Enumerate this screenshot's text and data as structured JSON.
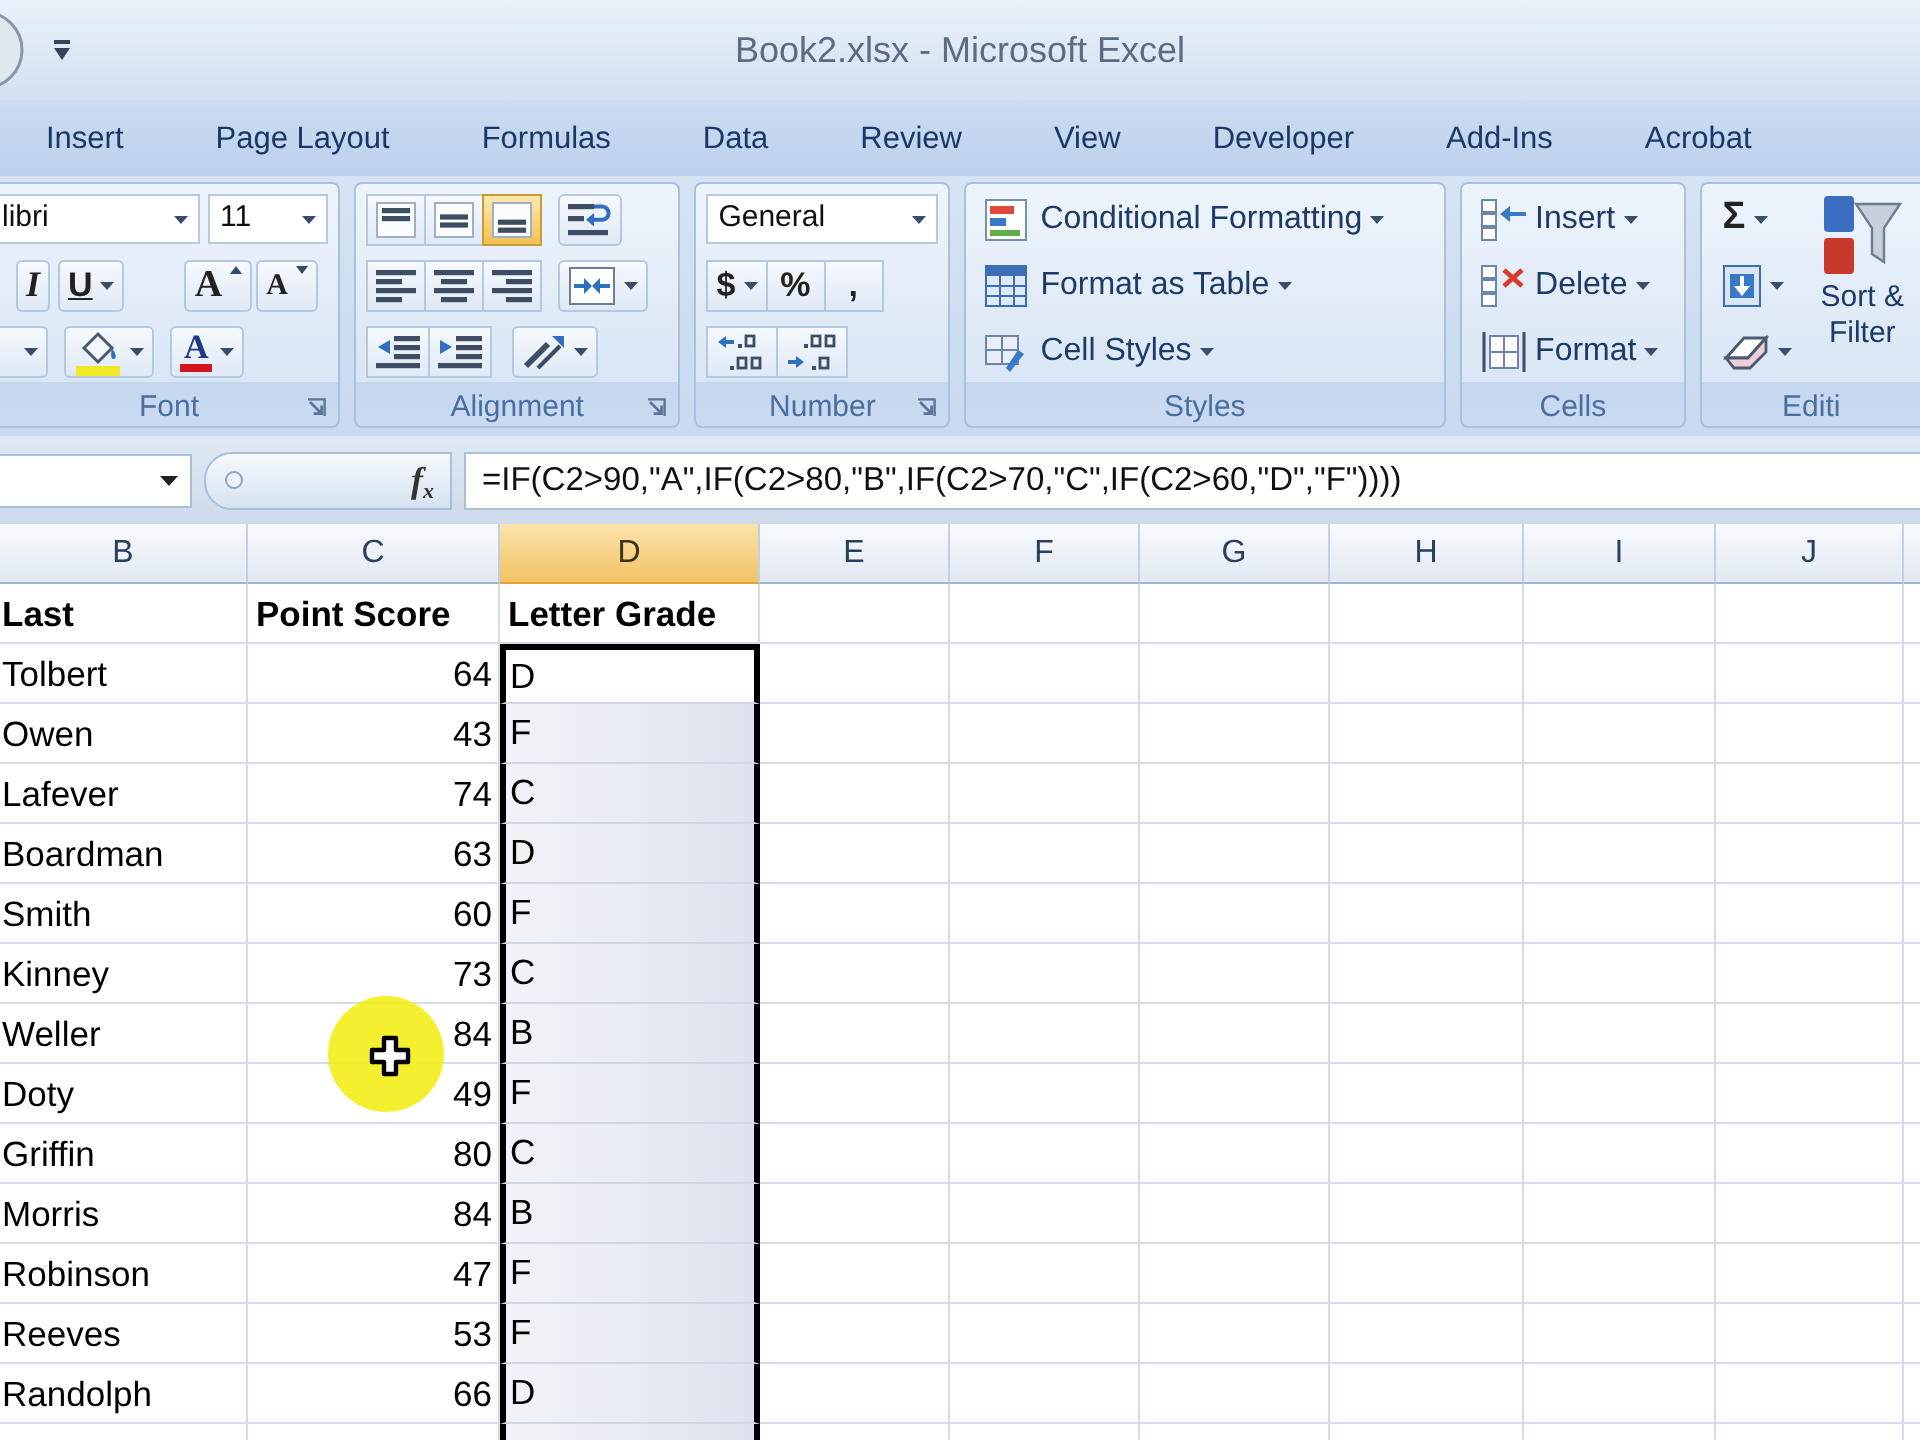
{
  "window": {
    "title": "Book2.xlsx - Microsoft Excel"
  },
  "ribbon": {
    "tabs": [
      {
        "label": "Insert",
        "selected": false
      },
      {
        "label": "Page Layout",
        "selected": false
      },
      {
        "label": "Formulas",
        "selected": false
      },
      {
        "label": "Data",
        "selected": false
      },
      {
        "label": "Review",
        "selected": false
      },
      {
        "label": "View",
        "selected": false
      },
      {
        "label": "Developer",
        "selected": false
      },
      {
        "label": "Add-Ins",
        "selected": false
      },
      {
        "label": "Acrobat",
        "selected": false
      }
    ],
    "groups": [
      {
        "kind": "font",
        "label": "Font",
        "font_name": "libri",
        "font_size": "11",
        "style_buttons": [
          {
            "glyph": "I",
            "dropdown": false
          },
          {
            "glyph": "U",
            "dropdown": true
          }
        ],
        "size_buttons": [
          "A",
          "A"
        ],
        "font_color_glyph": "A"
      },
      {
        "kind": "alignment",
        "label": "Alignment",
        "buttons": [
          {
            "on": false
          },
          {
            "on": false
          },
          {
            "on": true
          },
          {
            "on": false
          },
          {
            "on": false
          },
          {
            "on": false
          }
        ]
      },
      {
        "kind": "number",
        "label": "Number",
        "format": "General",
        "glyph_buttons": [
          {
            "glyph": "$",
            "dropdown": true
          },
          {
            "glyph": "%",
            "dropdown": false
          },
          {
            "glyph": ",",
            "dropdown": false
          }
        ]
      },
      {
        "kind": "styles",
        "label": "Styles",
        "commands": [
          "Conditional Formatting",
          "Format as Table",
          "Cell Styles"
        ]
      },
      {
        "kind": "cells",
        "label": "Cells",
        "commands": [
          "Insert",
          "Delete",
          "Format"
        ]
      },
      {
        "kind": "editing",
        "label": "Editi",
        "sum_glyph": "Σ",
        "sort_filter": [
          "Sort &",
          "Filter"
        ]
      }
    ]
  },
  "formula_bar": {
    "function_label": "f$_{x}$",
    "formula": "=IF(C2>90,\"A\",IF(C2>80,\"B\",IF(C2>70,\"C\",IF(C2>60,\"D\",\"F\"))))"
  },
  "sheet": {
    "columns": [
      {
        "label": "B",
        "selected": false
      },
      {
        "label": "C",
        "selected": false
      },
      {
        "label": "D",
        "selected": true
      },
      {
        "label": "E",
        "selected": false
      },
      {
        "label": "F",
        "selected": false
      },
      {
        "label": "G",
        "selected": false
      },
      {
        "label": "H",
        "selected": false
      },
      {
        "label": "I",
        "selected": false
      },
      {
        "label": "J",
        "selected": false
      }
    ],
    "rows": [
      {
        "kind": "header",
        "cells": [
          "Last",
          "Point Score",
          "Letter Grade"
        ],
        "selected": false,
        "active": false
      },
      {
        "kind": "data",
        "cells": [
          "Tolbert",
          "64",
          "D"
        ],
        "selected": true,
        "active": true
      },
      {
        "kind": "data",
        "cells": [
          "Owen",
          "43",
          "F"
        ],
        "selected": true,
        "active": false
      },
      {
        "kind": "data",
        "cells": [
          "Lafever",
          "74",
          "C"
        ],
        "selected": true,
        "active": false
      },
      {
        "kind": "data",
        "cells": [
          "Boardman",
          "63",
          "D"
        ],
        "selected": true,
        "active": false
      },
      {
        "kind": "data",
        "cells": [
          "Smith",
          "60",
          "F"
        ],
        "selected": true,
        "active": false
      },
      {
        "kind": "data",
        "cells": [
          "Kinney",
          "73",
          "C"
        ],
        "selected": true,
        "active": false
      },
      {
        "kind": "data",
        "cells": [
          "Weller",
          "84",
          "B"
        ],
        "selected": true,
        "active": false
      },
      {
        "kind": "data",
        "cells": [
          "Doty",
          "49",
          "F"
        ],
        "selected": true,
        "active": false
      },
      {
        "kind": "data",
        "cells": [
          "Griffin",
          "80",
          "C"
        ],
        "selected": true,
        "active": false
      },
      {
        "kind": "data",
        "cells": [
          "Morris",
          "84",
          "B"
        ],
        "selected": true,
        "active": false
      },
      {
        "kind": "data",
        "cells": [
          "Robinson",
          "47",
          "F"
        ],
        "selected": true,
        "active": false
      },
      {
        "kind": "data",
        "cells": [
          "Reeves",
          "53",
          "F"
        ],
        "selected": true,
        "active": false
      },
      {
        "kind": "data",
        "cells": [
          "Randolph",
          "66",
          "D"
        ],
        "selected": true,
        "active": false
      }
    ]
  }
}
